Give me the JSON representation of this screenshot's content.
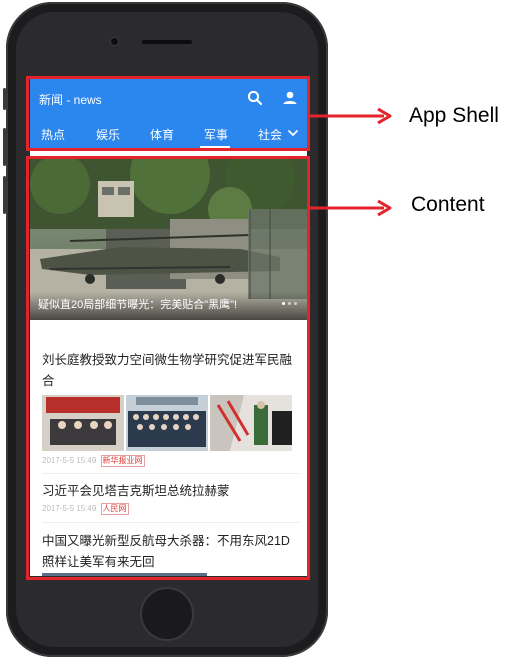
{
  "app": {
    "title": "新闻 - news",
    "tabs": [
      "热点",
      "娱乐",
      "体育",
      "军事",
      "社会"
    ],
    "active_tab": "军事"
  },
  "hero": {
    "caption": "疑似直20局部细节曝光：完美贴合\"黑鹰\"!"
  },
  "articles": [
    {
      "title": "刘长庭教授致力空间微生物学研究促进军民融合",
      "time": "2017-5-5 15:49",
      "source": "新华报业网"
    },
    {
      "title": "习近平会见塔吉克斯坦总统拉赫蒙",
      "time": "2017-5-5 15:49",
      "source": "人民网"
    },
    {
      "title": "中国又曝光新型反航母大杀器：不用东风21D照样让美军有来无回"
    }
  ],
  "annotations": {
    "app_shell": "App Shell",
    "content": "Content"
  },
  "colors": {
    "accent": "#2b86ee",
    "annotation": "#e5232b"
  }
}
